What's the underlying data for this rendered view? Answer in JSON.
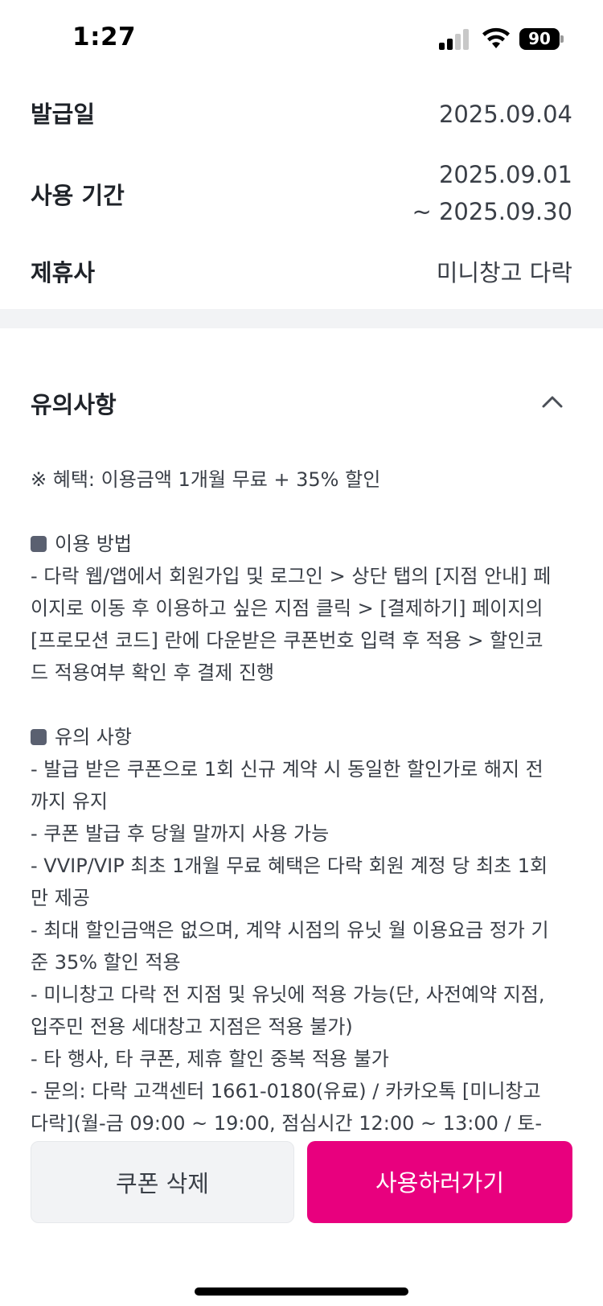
{
  "status_bar": {
    "time": "1:27",
    "battery_level": "90",
    "signal_icon": "cellular-signal-icon",
    "wifi_icon": "wifi-icon",
    "battery_icon": "battery-icon"
  },
  "coupon_info": {
    "rows": [
      {
        "label": "발급일",
        "value_lines": [
          "2025.09.04"
        ]
      },
      {
        "label": "사용 기간",
        "value_lines": [
          "2025.09.01",
          "~ 2025.09.30"
        ]
      },
      {
        "label": "제휴사",
        "value_lines": [
          "미니창고 다락"
        ]
      }
    ]
  },
  "notice": {
    "title": "유의사항",
    "toggle_icon": "chevron-up-icon",
    "benefit": "※ 혜택: 이용금액 1개월 무료 + 35% 할인",
    "usage_heading": "이용 방법",
    "usage_lines": [
      "- 다락 웹/앱에서 회원가입 및 로그인 > 상단 탭의 [지점 안내] 페",
      "이지로 이동 후 이용하고 싶은 지점 클릭 > [결제하기] 페이지의",
      "[프로모션 코드] 란에 다운받은 쿠폰번호 입력 후 적용 > 할인코",
      "드 적용여부 확인 후 결제 진행"
    ],
    "caution_heading": "유의 사항",
    "caution_lines": [
      "- 발급 받은 쿠폰으로 1회 신규 계약 시 동일한 할인가로 해지 전",
      "까지 유지",
      "- 쿠폰 발급 후 당월 말까지 사용 가능",
      "- VVIP/VIP 최초 1개월 무료 혜택은 다락 회원 계정 당 최초 1회",
      "만 제공",
      "- 최대 할인금액은 없으며, 계약 시점의 유닛 월 이용요금 정가 기",
      "준 35% 할인 적용",
      "- 미니창고 다락 전 지점 및 유닛에 적용 가능(단, 사전예약 지점,",
      "입주민 전용 세대창고 지점은 적용 불가)",
      "- 타 행사, 타 쿠폰, 제휴 할인 중복 적용 불가",
      "- 문의: 다락 고객센터 1661-0180(유료) / 카카오톡 [미니창고",
      "다락](월-금 09:00 ~ 19:00, 점심시간 12:00 ~ 13:00 / 토-"
    ]
  },
  "actions": {
    "delete_label": "쿠폰 삭제",
    "use_label": "사용하러가기"
  },
  "colors": {
    "accent": "#e8007e",
    "secondary_button": "#f2f3f5",
    "divider": "#f2f3f5"
  }
}
